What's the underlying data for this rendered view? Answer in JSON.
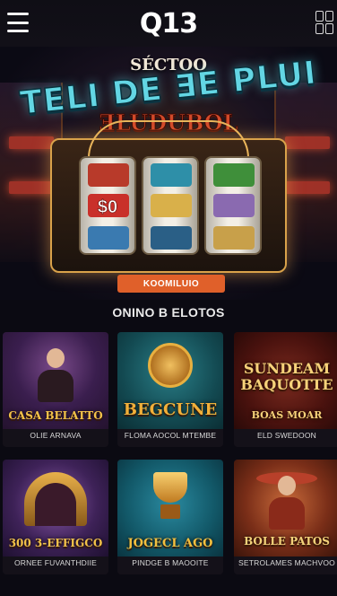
{
  "header": {
    "logo": "Q13"
  },
  "hero": {
    "subtitle": "SÉCTOO",
    "title": "TELI DE ƎE PLUI",
    "title2": "ƎLUDUBOL",
    "reel_center_values": [
      "$0",
      "",
      ""
    ],
    "cta_label": "KOOMILUIO"
  },
  "section_title": "ONINO B ELOTOS",
  "games": [
    {
      "name": "CASA BELATTO",
      "sub": "OLIE ARNAVA",
      "name_color": "#f2c24a"
    },
    {
      "name": "BEGCUNE",
      "sub": "FLOMA AOCOL MTEMBE",
      "name_color": "#f1b03a"
    },
    {
      "name": "SUNDEAM BAQUOTTE",
      "sub": "BOAS MOAR",
      "sub2": "ELD SWEDOON",
      "name_color": "#f7d27a"
    },
    {
      "name": "300 3-EFFIGCO",
      "sub": "ORNEE FUVANTHDIIE",
      "name_color": "#f2c24a"
    },
    {
      "name": "JOGECL AGO",
      "sub": "PINDGE B MAOOITE",
      "name_color": "#f3c040"
    },
    {
      "name": "BOLLE PATOS",
      "sub": "SETROLAMES MACHVOO",
      "name_color": "#f3d27a"
    }
  ]
}
